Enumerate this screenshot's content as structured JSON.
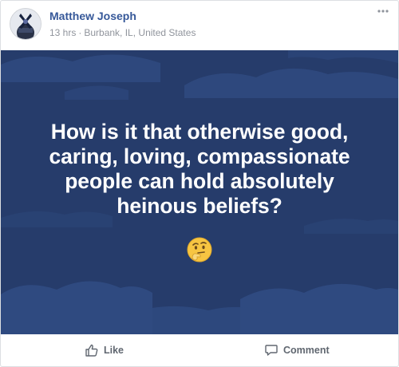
{
  "post": {
    "author_name": "Matthew Joseph",
    "time": "13 hrs",
    "separator": "·",
    "location": "Burbank, IL, United States",
    "more_label": "···"
  },
  "image": {
    "text_lines": [
      "How is it that otherwise good,",
      "caring, loving, compassionate",
      "people can hold absolutely",
      "heinous beliefs?"
    ],
    "emoji": "thinking-face",
    "background_color": "#263c6b",
    "cloud_color": "#2f4a80"
  },
  "actions": {
    "like_label": "Like",
    "comment_label": "Comment"
  },
  "colors": {
    "author": "#365899",
    "meta": "#90949c",
    "action_text": "#606770"
  }
}
